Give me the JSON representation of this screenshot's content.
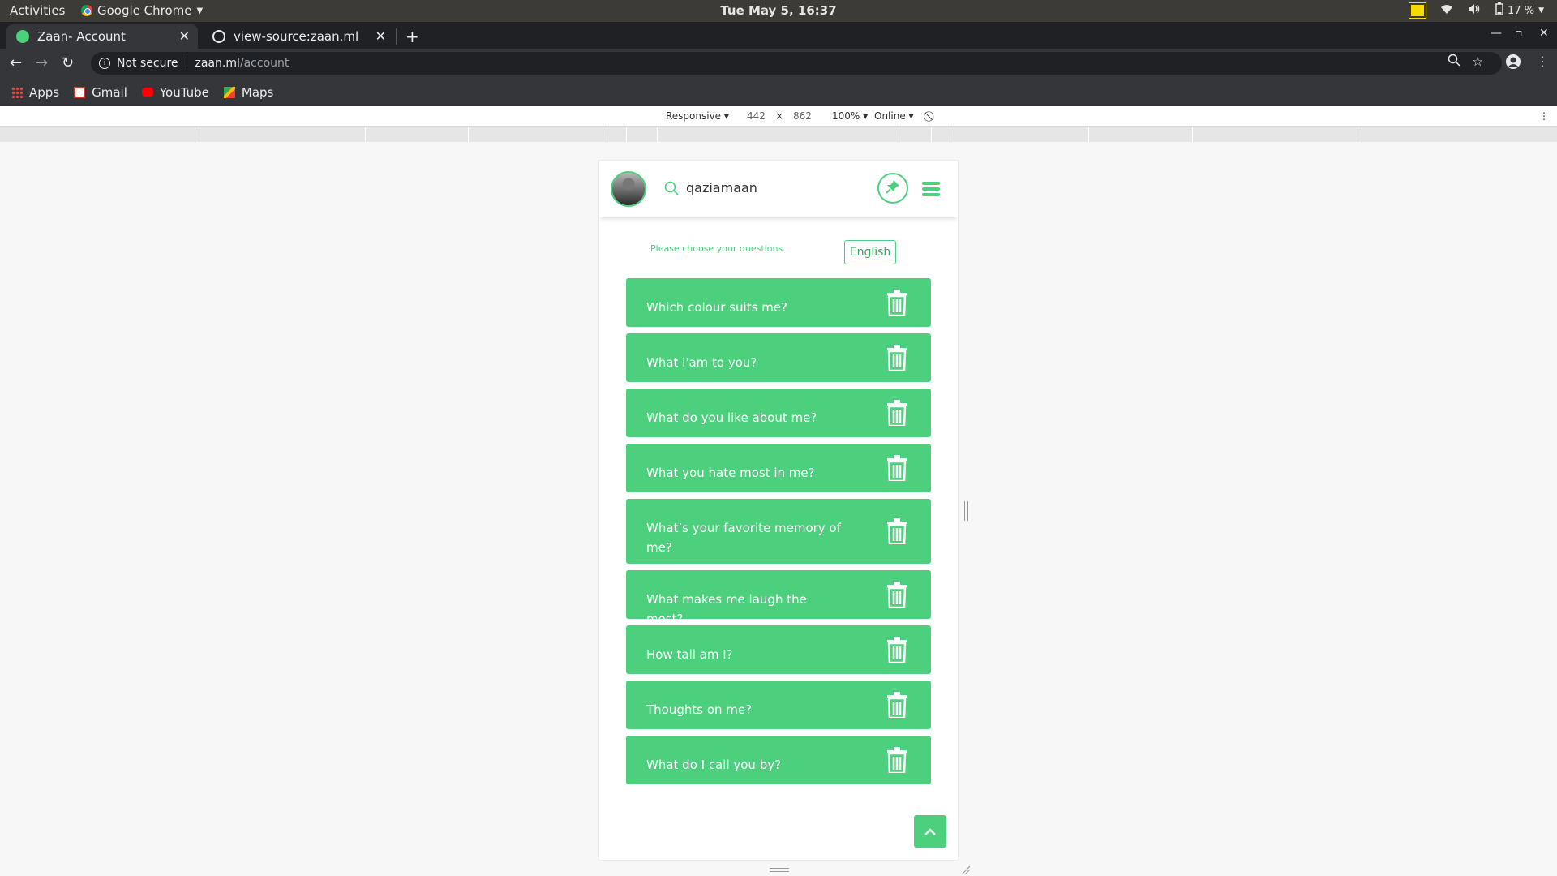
{
  "system": {
    "activities": "Activities",
    "app_name": "Google Chrome",
    "clock": "Tue May  5, 16:37",
    "battery": "17 %"
  },
  "tabs": [
    {
      "title": "Zaan- Account"
    },
    {
      "title": "view-source:zaan.ml"
    }
  ],
  "address_bar": {
    "security": "Not secure",
    "host": "zaan.ml",
    "path": "/account"
  },
  "bookmarks": [
    {
      "label": "Apps"
    },
    {
      "label": "Gmail"
    },
    {
      "label": "YouTube"
    },
    {
      "label": "Maps"
    }
  ],
  "devtools": {
    "device": "Responsive",
    "width": "442",
    "times": "×",
    "height": "862",
    "zoom": "100%",
    "network": "Online"
  },
  "app": {
    "username": "qaziamaan",
    "prompt": "Please choose your questions.",
    "language": "English",
    "questions": [
      "Which colour suits me?",
      "What i'am to you?",
      "What do you like about me?",
      "What you hate most in me?",
      "What’s your favorite memory of me?",
      "What makes me laugh the most?",
      "How tall am I?",
      "Thoughts on me?",
      "What do I call you by?"
    ]
  },
  "colors": {
    "accent": "#4cd07d",
    "chrome_dark": "#202124",
    "chrome_toolbar": "#35363a",
    "ubuntu_bar": "#3c3b37"
  }
}
